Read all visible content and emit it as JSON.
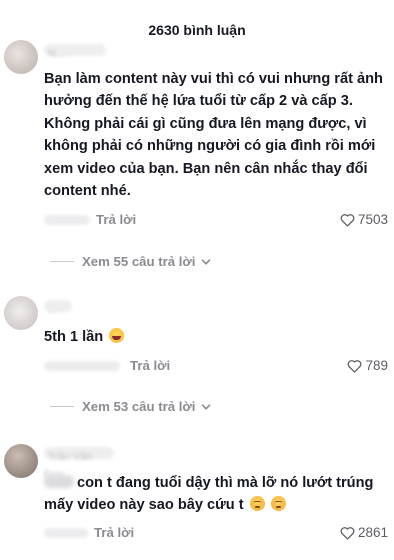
{
  "header": {
    "title": "2630 bình luận"
  },
  "comments": [
    {
      "username": "N...",
      "text": "Bạn làm content này vui thì có vui nhưng rất ảnh hưởng đến thế hệ lứa tuổi từ cấp 2 và cấp 3. Không phải cái gì cũng đưa lên mạng được, vì không phải có những người có gia đình rồi mới xem video của bạn. Bạn nên cân nhắc thay đổi content nhé.",
      "reply_label": "Trả lời",
      "likes": "7503",
      "view_replies": "Xem 55 câu trả lời"
    },
    {
      "username": "...",
      "text": "5th 1 lần",
      "emoji": "laughing-emoji",
      "reply_label": "Trả lời",
      "likes": "789",
      "view_replies": "Xem 53 câu trả lời"
    },
    {
      "username": "Trần Văn Đức",
      "text": "con t đang tuổi dậy thì mà lỡ nó lướt trúng mấy video này sao bây cứu t",
      "emoji": "pensive-emoji",
      "reply_label": "Trả lời",
      "likes": "2861"
    }
  ],
  "icons": {
    "like": "heart-outline-icon",
    "expand": "chevron-down-icon"
  },
  "colors": {
    "text_primary": "#161823",
    "text_secondary": "#8a8b91",
    "background": "#ffffff"
  }
}
